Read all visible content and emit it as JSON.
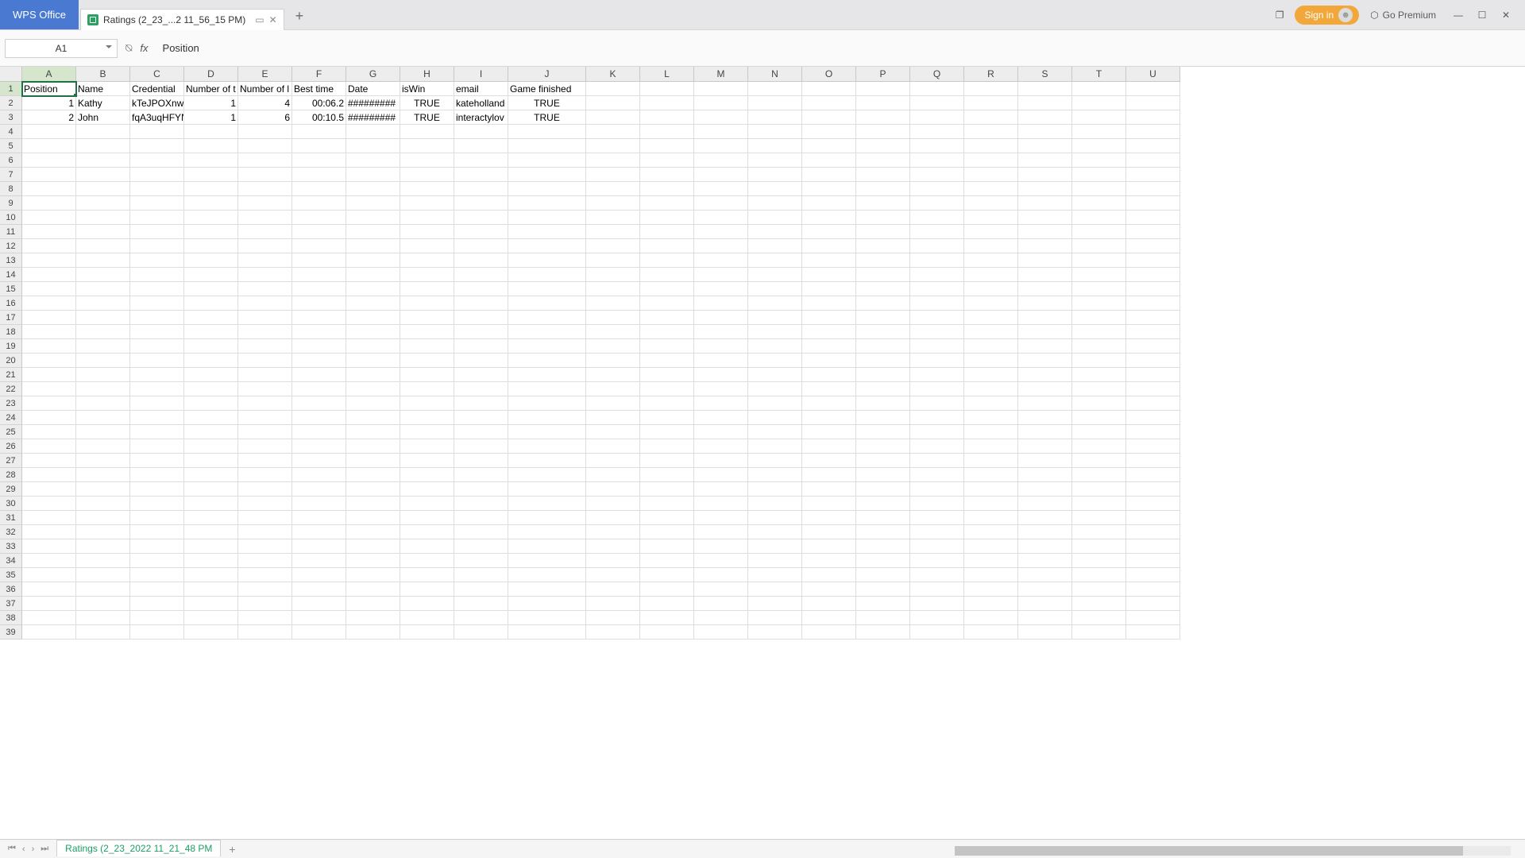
{
  "titlebar": {
    "home_tab": "WPS Office",
    "file_tab": "Ratings (2_23_...2 11_56_15 PM)",
    "signin": "Sign in",
    "go_premium": "Go Premium"
  },
  "formula": {
    "cell_ref": "A1",
    "value": "Position"
  },
  "spreadsheet": {
    "col_width_default": 68,
    "columns": [
      "A",
      "B",
      "C",
      "D",
      "E",
      "F",
      "G",
      "H",
      "I",
      "J",
      "K",
      "L",
      "M",
      "N",
      "O",
      "P",
      "Q",
      "R",
      "S",
      "T",
      "U"
    ],
    "visible_rows": 39,
    "header_row": [
      "Position",
      "Name",
      "Credential",
      "Number of t",
      "Number of l",
      "Best time",
      "Date",
      "isWin",
      "email",
      "Game finished"
    ],
    "data": [
      {
        "position": "1",
        "name": "Kathy",
        "credential": "kTeJPOXnw",
        "num1": "1",
        "num2": "4",
        "best_time": "00:06.2",
        "date": "#########",
        "iswin": "TRUE",
        "email": "kateholland",
        "finished": "TRUE"
      },
      {
        "position": "2",
        "name": "John",
        "credential": "fqA3uqHFYN",
        "num1": "1",
        "num2": "6",
        "best_time": "00:10.5",
        "date": "#########",
        "iswin": "TRUE",
        "email": "interactylov",
        "finished": "TRUE"
      }
    ]
  },
  "statusbar": {
    "sheet_name": "Ratings (2_23_2022 11_21_48 PM"
  }
}
